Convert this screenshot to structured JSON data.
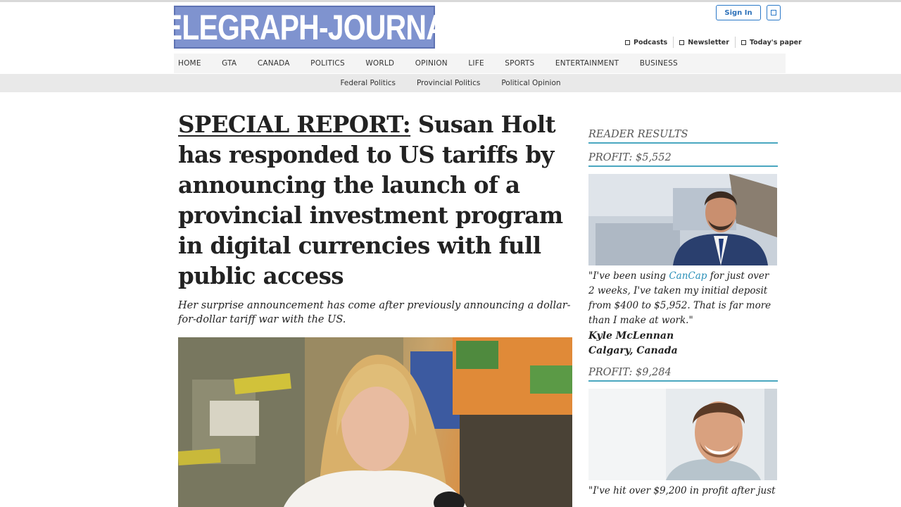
{
  "header": {
    "logo_text": "TELEGRAPH-JOURNAL",
    "signin_label": "Sign In",
    "utility_links": [
      "Podcasts",
      "Newsletter",
      "Today's paper"
    ]
  },
  "nav": {
    "items": [
      "HOME",
      "GTA",
      "CANADA",
      "POLITICS",
      "WORLD",
      "OPINION",
      "LIFE",
      "SPORTS",
      "ENTERTAINMENT",
      "BUSINESS"
    ]
  },
  "subnav": {
    "items": [
      "Federal Politics",
      "Provincial Politics",
      "Political Opinion"
    ]
  },
  "article": {
    "tag": "SPECIAL REPORT:",
    "headline": " Susan Holt has responded to US tariffs by announcing the launch of a provincial investment program in digital currencies with full public access",
    "deck": "Her surprise announcement has come after previously announcing a dollar-for-dollar tariff war with the US."
  },
  "sidebar": {
    "heading": "READER RESULTS",
    "testimonials": [
      {
        "profit": "PROFIT: $5,552",
        "quote_before": "\"I've been using ",
        "brand": "CanCap",
        "quote_after": " for just over 2 weeks, I've taken my initial deposit from $400 to $5,952. That is far more than I make at work.\"",
        "name": "Kyle McLennan",
        "location": "Calgary, Canada"
      },
      {
        "profit": "PROFIT: $9,284",
        "quote_text": "\"I've hit over $9,200 in profit after just"
      }
    ]
  },
  "colors": {
    "logo_bg": "#7f93cf",
    "accent_rule": "#4aa7c0",
    "link_blue": "#2a78c8"
  }
}
